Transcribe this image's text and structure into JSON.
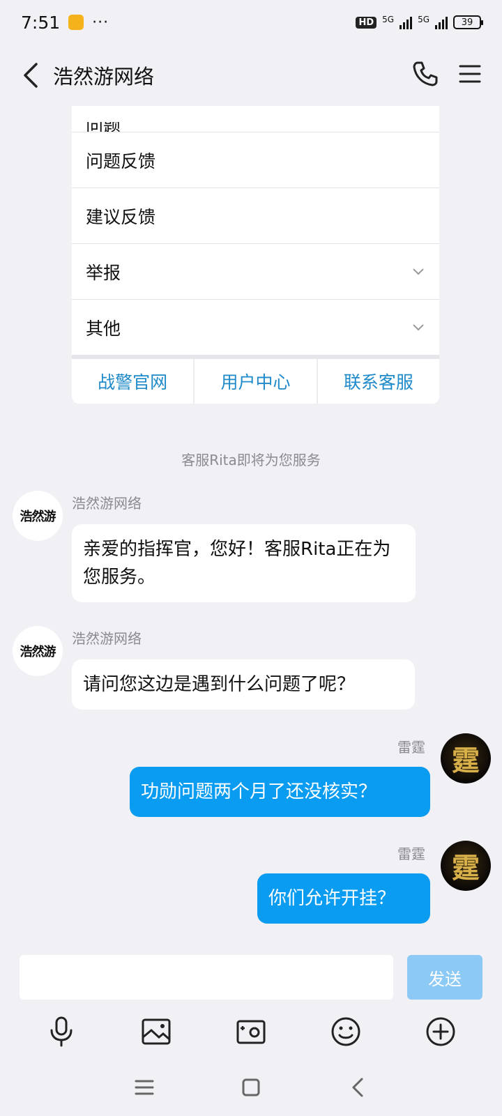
{
  "status_bar": {
    "time": "7:51",
    "more": "···",
    "network_hd": "HD",
    "network_label_1": "5G",
    "network_label_2": "5G",
    "battery": "39"
  },
  "header": {
    "title": "浩然游网络",
    "back_icon": "chevron-left-icon",
    "call_icon": "phone-icon",
    "menu_icon": "hamburger-menu-icon"
  },
  "menu_card": {
    "partial_item": "问题",
    "items": [
      {
        "label": "问题反馈",
        "expandable": false
      },
      {
        "label": "建议反馈",
        "expandable": false
      },
      {
        "label": "举报",
        "expandable": true
      },
      {
        "label": "其他",
        "expandable": true
      }
    ],
    "links": [
      "战警官网",
      "用户中心",
      "联系客服"
    ],
    "link_color": "#1e8ac9"
  },
  "system_note": "客服Rita即将为您服务",
  "messages": [
    {
      "side": "left",
      "sender": "浩然游网络",
      "avatar_text": "浩然游",
      "text": "亲爱的指挥官，您好！客服Rita正在为您服务。"
    },
    {
      "side": "left",
      "sender": "浩然游网络",
      "avatar_text": "浩然游",
      "text": "请问您这边是遇到什么问题了呢？"
    },
    {
      "side": "right",
      "sender": "雷霆",
      "avatar_text": "霆",
      "text": "功勋问题两个月了还没核实？"
    },
    {
      "side": "right",
      "sender": "雷霆",
      "avatar_text": "霆",
      "text": "你们允许开挂？"
    }
  ],
  "input": {
    "placeholder": "",
    "send_label": "发送"
  },
  "toolbar": [
    "microphone-icon",
    "image-icon",
    "camera-icon",
    "emoji-icon",
    "plus-circle-icon"
  ],
  "system_nav": [
    "menu-lines-icon",
    "home-square-icon",
    "back-chevron-icon"
  ],
  "colors": {
    "bubble_right": "#0a9cf0",
    "send_button": "#8ccaf5",
    "background": "#f0f0f5"
  }
}
